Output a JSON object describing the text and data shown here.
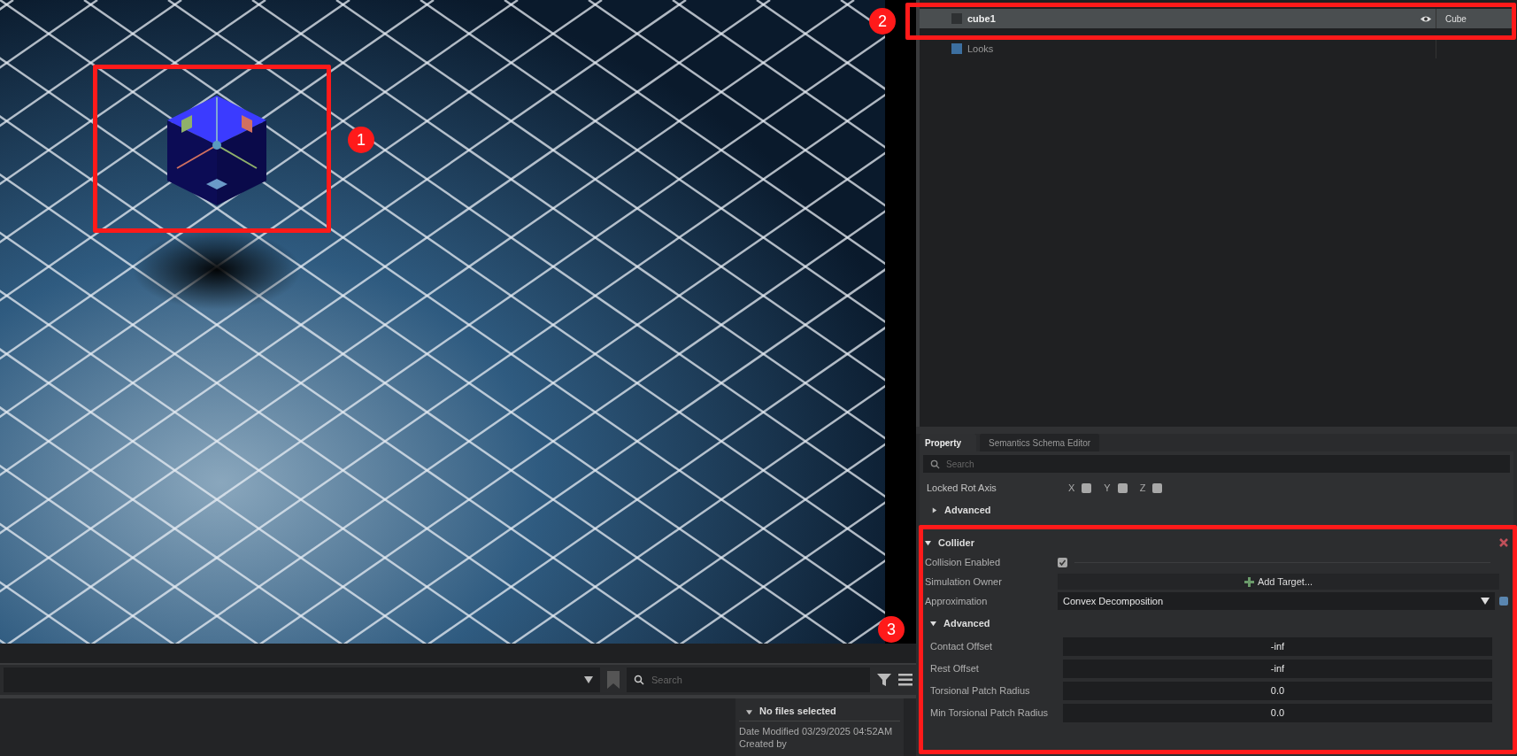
{
  "annotations": [
    {
      "label": "1"
    },
    {
      "label": "2"
    },
    {
      "label": "3"
    }
  ],
  "outliner": {
    "rows": [
      {
        "label": "cube1",
        "type": "Cube",
        "selected": true,
        "visible": true
      },
      {
        "label": "Looks",
        "selected": false
      }
    ]
  },
  "property": {
    "tabs": [
      {
        "label": "Property",
        "selected": true
      },
      {
        "label": "Semantics Schema Editor",
        "selected": false
      }
    ],
    "search": {
      "placeholder": "Search"
    },
    "locked_rot_axis": {
      "label": "Locked Rot Axis",
      "axes": [
        {
          "label": "X",
          "checked": false
        },
        {
          "label": "Y",
          "checked": false
        },
        {
          "label": "Z",
          "checked": false
        }
      ]
    },
    "advanced": {
      "label": "Advanced",
      "expanded": false
    },
    "collider": {
      "title": "Collider",
      "expanded": true,
      "rows": [
        {
          "kind": "checkbox",
          "label": "Collision Enabled",
          "checked": true
        },
        {
          "kind": "button",
          "label": "Simulation Owner",
          "button": "Add Target..."
        },
        {
          "kind": "dropdown",
          "label": "Approximation",
          "value": "Convex Decomposition"
        }
      ],
      "advanced": {
        "label": "Advanced",
        "expanded": true,
        "fields": [
          {
            "label": "Contact Offset",
            "value": "-inf"
          },
          {
            "label": "Rest Offset",
            "value": "-inf"
          },
          {
            "label": "Torsional Patch Radius",
            "value": "0.0"
          },
          {
            "label": "Min Torsional Patch Radius",
            "value": "0.0"
          }
        ]
      }
    }
  },
  "content_browser": {
    "search": {
      "placeholder": "Search"
    },
    "details": {
      "title": "No files selected",
      "expanded": true,
      "lines": [
        "Date Modified 03/29/2025 04:52AM",
        "Created by"
      ]
    }
  }
}
